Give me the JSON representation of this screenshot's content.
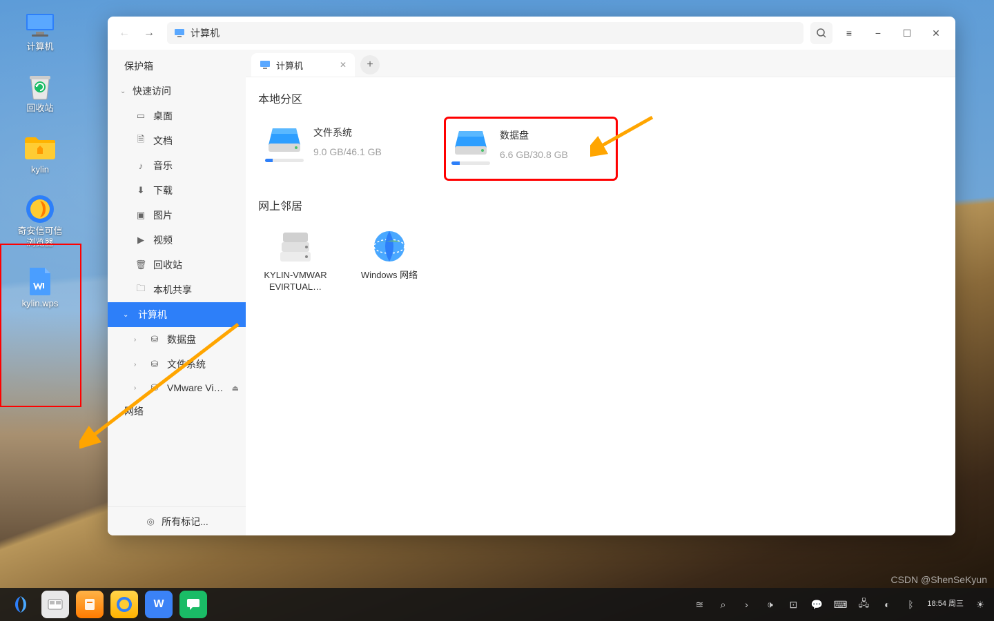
{
  "desktop": {
    "icons": [
      {
        "label": "计算机"
      },
      {
        "label": "回收站"
      },
      {
        "label": "kylin"
      },
      {
        "label": "奇安信可信\n浏览器"
      },
      {
        "label": "kylin.wps"
      }
    ]
  },
  "fm": {
    "nav": {
      "back": "←",
      "forward": "→"
    },
    "address": {
      "icon": "computer-icon",
      "label": "计算机"
    },
    "menu_icon": "≡",
    "window_buttons": {
      "min": "−",
      "max": "☐",
      "close": "✕"
    },
    "tab": {
      "label": "计算机",
      "close": "✕",
      "add": "+"
    },
    "sidebar": {
      "vault": "保护箱",
      "quick": "快速访问",
      "desktop": "桌面",
      "documents": "文档",
      "music": "音乐",
      "downloads": "下载",
      "pictures": "图片",
      "videos": "视频",
      "trash": "回收站",
      "share": "本机共享",
      "computer": "计算机",
      "datadisk": "数据盘",
      "filesystem": "文件系统",
      "vmware": "VMware Virtu…",
      "network": "网络",
      "footer": "所有标记..."
    },
    "content": {
      "local_partitions": "本地分区",
      "drives": [
        {
          "name": "文件系统",
          "used": "9.0 GB",
          "total": "46.1 GB",
          "pct": 20
        },
        {
          "name": "数据盘",
          "used": "6.6 GB",
          "total": "30.8 GB",
          "pct": 21
        }
      ],
      "network_neighborhood": "网上邻居",
      "net_items": [
        {
          "name": "KYLIN-VMWAREVIRTUAL…"
        },
        {
          "name": "Windows 网络"
        }
      ]
    }
  },
  "taskbar": {
    "time": "18:54",
    "day": "周三"
  },
  "watermark": "CSDN @ShenSeKyun"
}
